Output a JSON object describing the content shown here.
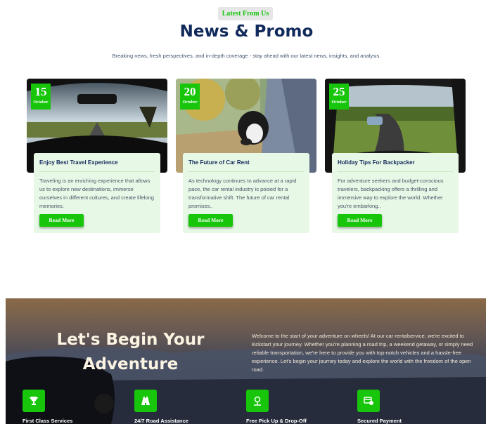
{
  "header": {
    "eyebrow": "Latest From Us",
    "title": "News & Promo",
    "subtitle": "Breaking news, fresh perspectives, and in-depth coverage - stay ahead with our latest news, insights, and analysis."
  },
  "cards": [
    {
      "day": "15",
      "month": "October",
      "title": "Enjoy Best Travel Experience",
      "text": "Traveling is an enriching experience that allows us to explore new destinations, immerse ourselves in different cultures, and create lifelong memories.",
      "button": "Read More",
      "image_icon": "car-dashboard-road-photo"
    },
    {
      "day": "20",
      "month": "October",
      "title": "The Future of Car Rent",
      "text": "As technology continues to advance at a rapid pace, the car rental industry is poised for a transformative shift. The future of car rental promises..",
      "button": "Read More",
      "image_icon": "dog-in-car-window-photo"
    },
    {
      "day": "25",
      "month": "October",
      "title": "Holiday Tips For Backpacker",
      "text": "For adventure seekers and budget-conscious travelers, backpacking offers a thrilling and immersive way to explore the world. Whether you're embarking..",
      "button": "Read More",
      "image_icon": "winding-road-windshield-photo"
    }
  ],
  "hero": {
    "title_line1": "Let's Begin Your",
    "title_line2": "Adventure",
    "text": "Welcome to the start of your adventure on wheels! At our car rentalservice, we're excited to kickstart your journey. Whether you're planning a road trip, a weekend getaway, or simply need reliable transportation, we're here to provide you with top-notch vehicles and a hassle-free experience. Let's begin your journey today and explore the world with the freedom of the open road.",
    "features": [
      {
        "label": "First Class Services",
        "icon": "trophy-icon"
      },
      {
        "label": "24/7 Road Assistance",
        "icon": "road-icon"
      },
      {
        "label": "Free Pick Up & Drop-Off",
        "icon": "map-pin-icon"
      },
      {
        "label": "Secured Payment",
        "icon": "secure-card-icon"
      }
    ]
  },
  "colors": {
    "accent": "#17c60b",
    "title": "#112a5c",
    "card_body": "#e8f8e6"
  }
}
